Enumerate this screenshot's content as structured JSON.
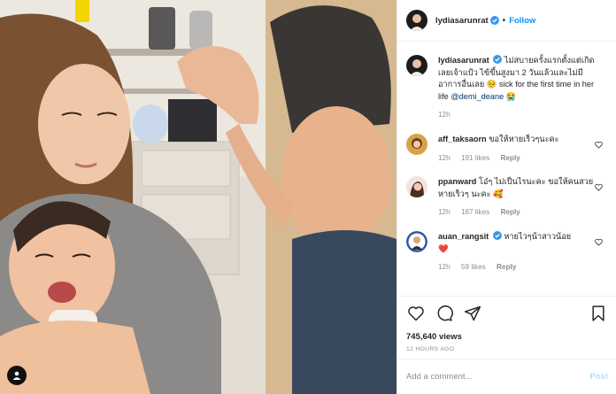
{
  "header": {
    "username": "lydiasarunrat",
    "follow_label": "Follow",
    "separator": "•"
  },
  "caption": {
    "username": "lydiasarunrat",
    "text": "ไม่สบายครั้งแรกตั้งแต่เกิดเลยเจ้าแป้ว ไข้ขึ้นสูงมา 2 วันแล้วและไม่มีอาการอื่นเลย 🥺 sick for the first time in her life",
    "mention": "@demi_deane",
    "emoji": "😭",
    "time": "12h"
  },
  "comments": [
    {
      "username": "aff_taksaorn",
      "text": "ขอให้หายเร็วๆนะคะ",
      "time": "12h",
      "likes": "191 likes",
      "reply": "Reply"
    },
    {
      "username": "ppanward",
      "text": "โอ๋ๆ ไม่เป็นไรนะคะ ขอให้คนสวยหายเร็วๆ นะคะ 🥰",
      "time": "12h",
      "likes": "187 likes",
      "reply": "Reply"
    },
    {
      "username": "auan_rangsit",
      "text": "หายไวๆน้าสาวน้อย",
      "emoji": "❤️",
      "time": "12h",
      "likes": "59 likes",
      "reply": "Reply"
    }
  ],
  "stats": {
    "views": "745,640 views",
    "posted": "12 HOURS AGO"
  },
  "composer": {
    "placeholder": "Add a comment...",
    "post_label": "Post"
  },
  "colors": {
    "link": "#0095f6",
    "muted": "#8e8e8e",
    "verified": "#3897f0",
    "heart": "#ed4956"
  },
  "icons": [
    "verified-badge-icon",
    "heart-icon",
    "comment-icon",
    "share-icon",
    "bookmark-icon",
    "user-tag-icon"
  ]
}
